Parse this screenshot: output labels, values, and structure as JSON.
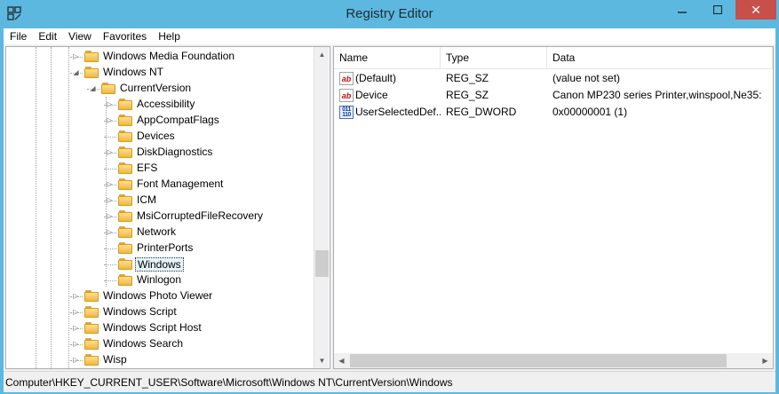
{
  "window": {
    "title": "Registry Editor",
    "close_glyph": "✕"
  },
  "menu": [
    "File",
    "Edit",
    "View",
    "Favorites",
    "Help"
  ],
  "tree": [
    {
      "label": "Windows Media Foundation",
      "level": 2,
      "expander": "▷"
    },
    {
      "label": "Windows NT",
      "level": 2,
      "expander": "◢"
    },
    {
      "label": "CurrentVersion",
      "level": 3,
      "expander": "◢"
    },
    {
      "label": "Accessibility",
      "level": 4,
      "expander": "▷"
    },
    {
      "label": "AppCompatFlags",
      "level": 4,
      "expander": "▷"
    },
    {
      "label": "Devices",
      "level": 4,
      "expander": ""
    },
    {
      "label": "DiskDiagnostics",
      "level": 4,
      "expander": "▷"
    },
    {
      "label": "EFS",
      "level": 4,
      "expander": ""
    },
    {
      "label": "Font Management",
      "level": 4,
      "expander": "▷"
    },
    {
      "label": "ICM",
      "level": 4,
      "expander": "▷"
    },
    {
      "label": "MsiCorruptedFileRecovery",
      "level": 4,
      "expander": "▷"
    },
    {
      "label": "Network",
      "level": 4,
      "expander": "▷"
    },
    {
      "label": "PrinterPorts",
      "level": 4,
      "expander": ""
    },
    {
      "label": "Windows",
      "level": 4,
      "expander": "",
      "selected": true
    },
    {
      "label": "Winlogon",
      "level": 4,
      "expander": ""
    },
    {
      "label": "Windows Photo Viewer",
      "level": 2,
      "expander": "▷"
    },
    {
      "label": "Windows Script",
      "level": 2,
      "expander": "▷"
    },
    {
      "label": "Windows Script Host",
      "level": 2,
      "expander": "▷"
    },
    {
      "label": "Windows Search",
      "level": 2,
      "expander": "▷"
    },
    {
      "label": "Wisp",
      "level": 2,
      "expander": "▷"
    }
  ],
  "list": {
    "columns": [
      "Name",
      "Type",
      "Data"
    ],
    "rows": [
      {
        "icon": "string-value-icon",
        "icon_glyph": "ab",
        "name": "(Default)",
        "type": "REG_SZ",
        "data": "(value not set)"
      },
      {
        "icon": "string-value-icon",
        "icon_glyph": "ab",
        "name": "Device",
        "type": "REG_SZ",
        "data": "Canon MP230 series Printer,winspool,Ne35:"
      },
      {
        "icon": "binary-value-icon",
        "icon_glyph": "011\n110",
        "name": "UserSelectedDef...",
        "type": "REG_DWORD",
        "data": "0x00000001 (1)"
      }
    ]
  },
  "status": {
    "path": "Computer\\HKEY_CURRENT_USER\\Software\\Microsoft\\Windows NT\\CurrentVersion\\Windows"
  },
  "scroll_glyphs": {
    "up": "▲",
    "down": "▼",
    "left": "◀",
    "right": "▶"
  },
  "colors": {
    "titlebar": "#5db8e0",
    "close_button": "#c7504a",
    "folder": "#f0b840",
    "selection": "#e5f3fb"
  }
}
